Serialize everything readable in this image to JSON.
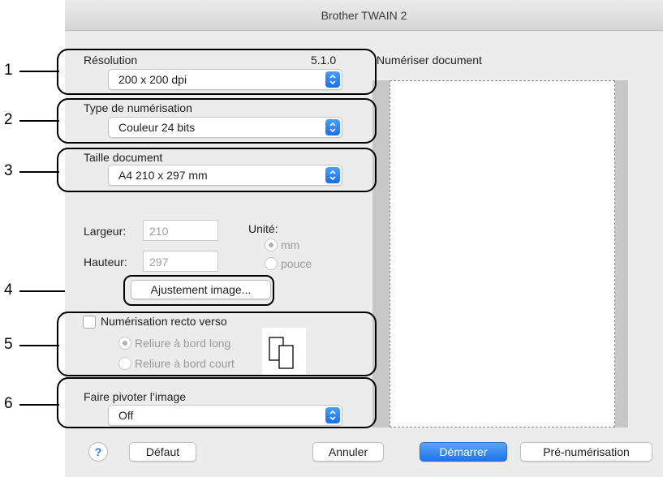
{
  "window": {
    "title": "Brother TWAIN 2"
  },
  "callouts": [
    "1",
    "2",
    "3",
    "4",
    "5",
    "6"
  ],
  "resolution": {
    "label": "Résolution",
    "version": "5.1.0",
    "value": "200 x 200 dpi"
  },
  "scan_type": {
    "label": "Type de numérisation",
    "value": "Couleur 24 bits"
  },
  "document_size": {
    "label": "Taille document",
    "value": "A4  210 x 297 mm"
  },
  "dimensions": {
    "width_label": "Largeur:",
    "width_value": "210",
    "height_label": "Hauteur:",
    "height_value": "297",
    "unit_label": "Unité:",
    "unit_mm": "mm",
    "unit_inch": "pouce"
  },
  "image_adjust": {
    "label": "Ajustement image..."
  },
  "duplex": {
    "label": "Numérisation recto verso",
    "long_edge": "Reliure à bord long",
    "short_edge": "Reliure à bord court"
  },
  "rotate": {
    "label": "Faire pivoter l’image",
    "value": "Off"
  },
  "preview": {
    "label": "Numériser document"
  },
  "buttons": {
    "help": "?",
    "default": "Défaut",
    "cancel": "Annuler",
    "start": "Démarrer",
    "prescan": "Pré-numérisation"
  },
  "colors": {
    "accent": "#1f74ea",
    "background": "#ececec"
  }
}
